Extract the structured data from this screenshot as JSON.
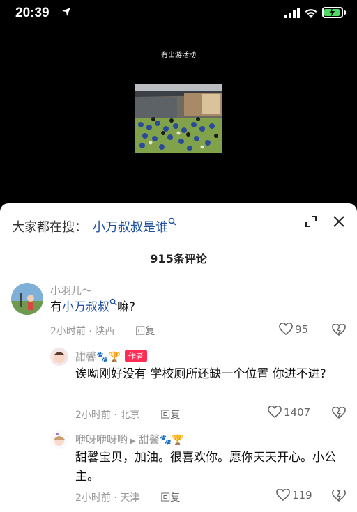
{
  "status_bar": {
    "time": "20:39"
  },
  "video": {
    "title": "有出游活动"
  },
  "sheet": {
    "search_prefix": "大家都在搜：",
    "search_term": "小万叔叔是谁",
    "comment_count": "915条评论"
  },
  "comments": [
    {
      "user": "小羽儿～",
      "text_prefix": "有",
      "text_highlight": "小万叔叔",
      "text_suffix": "嘛?",
      "meta": "2小时前 · 陕西",
      "reply": "回复",
      "likes": "95"
    },
    {
      "user": "甜馨",
      "badges": "🐾🏆",
      "tag": "作者",
      "text": "诶呦刚好没有 学校厕所还缺一个位置 你进不进?",
      "meta": "2小时前 · 北京",
      "reply": "回复",
      "likes": "1407"
    },
    {
      "user": "咿呀咿呀哟",
      "reply_to": "甜馨",
      "badges": "🐾🏆",
      "text": "甜馨宝贝，加油。很喜欢你。愿你天天开心。小公主。",
      "meta": "2小时前 · 天津",
      "reply": "回复",
      "likes": "119"
    }
  ],
  "colors": {
    "accent": "#1f4fa0",
    "author_tag": "#ff2d55",
    "battery": "#4cd964"
  }
}
